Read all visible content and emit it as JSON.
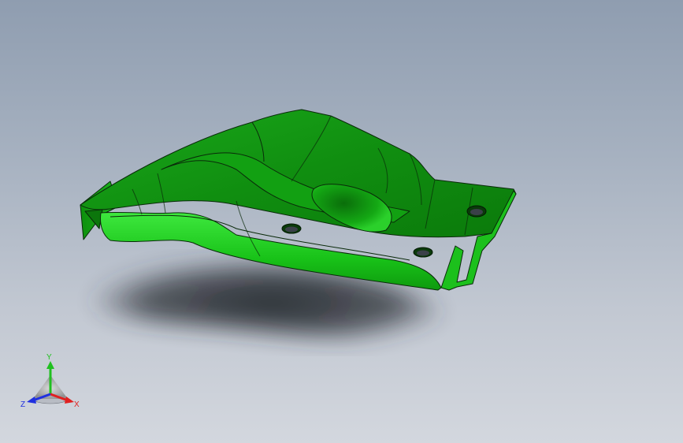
{
  "viewport": {
    "background_top": "#8f9db0",
    "background_bottom": "#d3d7de",
    "model": {
      "name": "sheet-metal-bracket",
      "color": "#16c016",
      "edge_color": "#0a2a0a",
      "holes": 3
    }
  },
  "triad": {
    "x_label": "X",
    "y_label": "Y",
    "z_label": "Z",
    "x_color": "#e02020",
    "y_color": "#20c020",
    "z_color": "#2030e0"
  }
}
